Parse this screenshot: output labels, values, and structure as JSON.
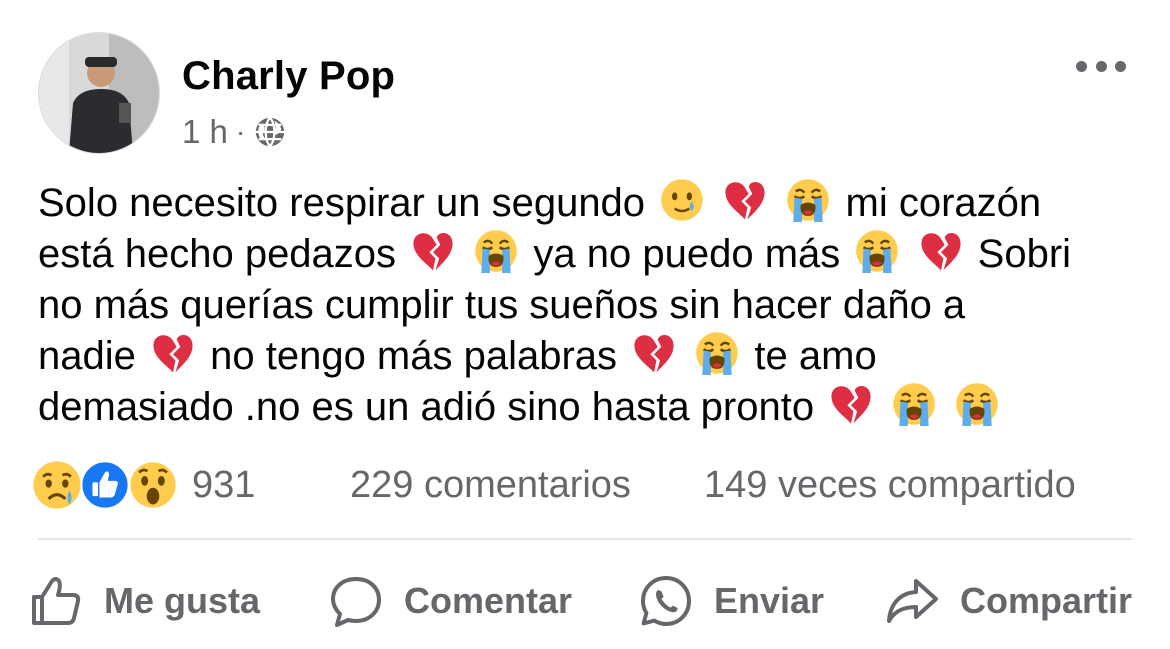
{
  "post": {
    "author": "Charly Pop",
    "time": "1 h",
    "dot": "·",
    "audience_icon": "globe-icon",
    "text_lines": [
      [
        "Solo necesito respirar un segundo ",
        {
          "emoji": "tear-smile"
        },
        {
          "emoji": "broken-heart"
        },
        {
          "emoji": "crying"
        },
        "mi corazón"
      ],
      [
        "está hecho pedazos ",
        {
          "emoji": "broken-heart"
        },
        {
          "emoji": "crying"
        },
        " ya no puedo más ",
        {
          "emoji": "crying"
        },
        {
          "emoji": "broken-heart"
        },
        "Sobri"
      ],
      [
        "no más querías cumplir tus sueños sin hacer daño a"
      ],
      [
        "nadie ",
        {
          "emoji": "broken-heart"
        },
        "no tengo más palabras ",
        {
          "emoji": "broken-heart"
        },
        {
          "emoji": "crying"
        },
        "te amo"
      ],
      [
        "demasiado .no es un adió sino hasta pronto ",
        {
          "emoji": "broken-heart"
        },
        {
          "emoji": "crying"
        },
        {
          "emoji": "crying"
        }
      ]
    ]
  },
  "stats": {
    "reactions": [
      "sad",
      "like",
      "wow"
    ],
    "reaction_count": "931",
    "comments": "229 comentarios",
    "shares": "149 veces compartido"
  },
  "actions": {
    "like": "Me gusta",
    "comment": "Comentar",
    "send": "Enviar",
    "share": "Compartir"
  },
  "colors": {
    "text": "#050505",
    "secondary": "#65676b",
    "like_blue": "#1877f2",
    "emoji_yellow": "#ffcc4d",
    "heart_red": "#dd2e44"
  }
}
